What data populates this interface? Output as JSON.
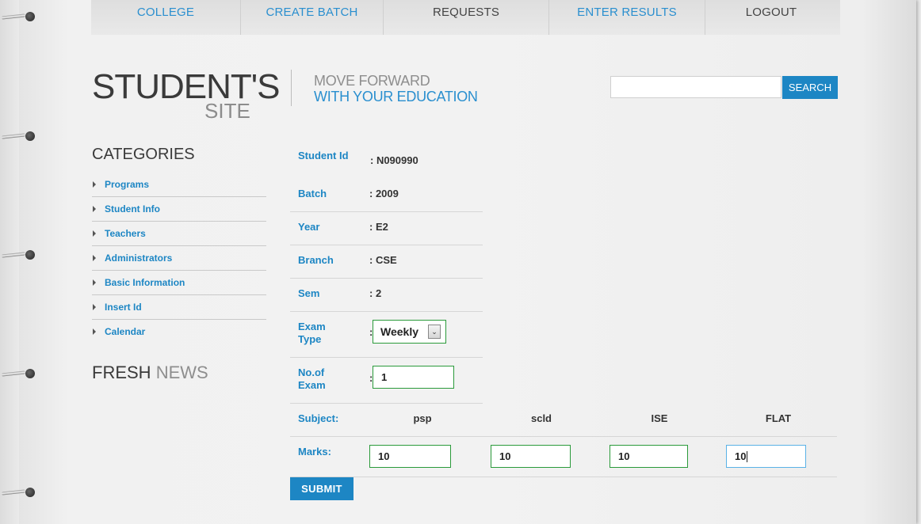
{
  "nav": {
    "items": [
      {
        "label": "COLLEGE"
      },
      {
        "label": "CREATE BATCH"
      },
      {
        "label": "REQUESTS"
      },
      {
        "label": "ENTER RESULTS"
      },
      {
        "label": "LOGOUT"
      }
    ]
  },
  "header": {
    "logo_main": "STUDENT'S",
    "logo_sub": "SITE",
    "tagline_1": "MOVE FORWARD",
    "tagline_2": "WITH YOUR EDUCATION",
    "search_button": "SEARCH",
    "search_value": ""
  },
  "sidebar": {
    "title": "CATEGORIES",
    "items": [
      {
        "label": "Programs"
      },
      {
        "label": "Student Info"
      },
      {
        "label": "Teachers"
      },
      {
        "label": "Administrators"
      },
      {
        "label": "Basic Information"
      },
      {
        "label": "Insert Id"
      },
      {
        "label": "Calendar"
      }
    ],
    "news_title_1": "FRESH",
    "news_title_2": "NEWS"
  },
  "form": {
    "student_id_label": "Student Id",
    "student_id_value": ": N090990",
    "batch_label": "Batch",
    "batch_value": ": 2009",
    "year_label": "Year",
    "year_value": ": E2",
    "branch_label": "Branch",
    "branch_value": ": CSE",
    "sem_label": "Sem",
    "sem_value": ": 2",
    "exam_type_label_1": "Exam",
    "exam_type_label_2": "Type",
    "exam_type_value": "Weekly",
    "no_of_exam_label_1": "No.of",
    "no_of_exam_label_2": "Exam",
    "no_of_exam_value": "1",
    "colon": ":",
    "subject_label": "Subject:",
    "marks_label": "Marks:",
    "subjects": [
      "psp",
      "scld",
      "ISE",
      "FLAT"
    ],
    "marks": [
      "10",
      "10",
      "10",
      "10"
    ],
    "submit_label": "SUBMIT"
  },
  "colors": {
    "accent": "#1d86c4",
    "nav_blue": "#2a8fcf",
    "field_border": "#2a9a3a"
  }
}
